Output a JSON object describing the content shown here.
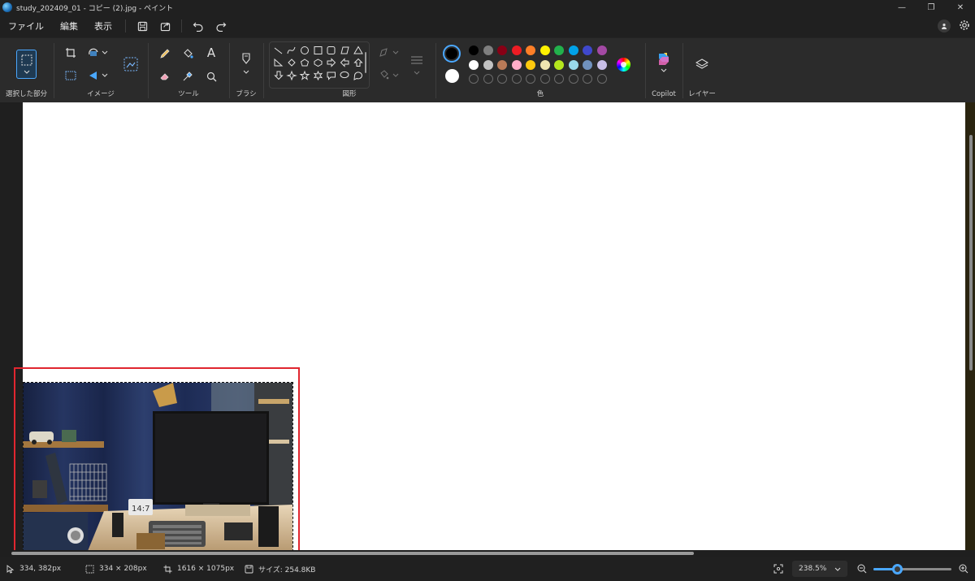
{
  "window": {
    "title": "study_202409_01 - コピー (2).jpg - ペイント",
    "minimize": "—",
    "restore": "❐",
    "close": "✕"
  },
  "menu": {
    "file": "ファイル",
    "edit": "編集",
    "view": "表示"
  },
  "ribbon": {
    "selection_label": "選択した部分",
    "image_label": "イメージ",
    "tools_label": "ツール",
    "brush_label": "ブラシ",
    "shapes_label": "図形",
    "colors_label": "色",
    "copilot_label": "Copilot",
    "layers_label": "レイヤー",
    "text_tool": "A"
  },
  "colors": {
    "primary": "#000000",
    "secondary": "#ffffff",
    "row1": [
      "#000000",
      "#7f7f7f",
      "#880015",
      "#ed1c24",
      "#ff7f27",
      "#fff200",
      "#22b14c",
      "#00a2e8",
      "#3f48cc",
      "#a349a4"
    ],
    "row2": [
      "#ffffff",
      "#c3c3c3",
      "#b97a57",
      "#ffaec9",
      "#ffc90e",
      "#efe4b0",
      "#b5e61d",
      "#99d9ea",
      "#7092be",
      "#c8bfe7"
    ]
  },
  "status": {
    "cursor_pos": "334, 382px",
    "selection_size": "334 × 208px",
    "canvas_size": "1616 × 1075px",
    "file_size": "サイズ: 254.8KB",
    "zoom": "238.5%",
    "zoom_level": 0.31
  }
}
